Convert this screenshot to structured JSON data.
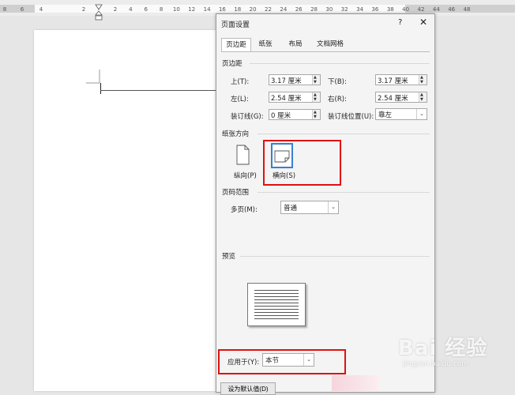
{
  "ruler": {
    "left_ticks": [
      "8",
      "6",
      "4",
      "2"
    ],
    "right_ticks": [
      "2",
      "4",
      "6",
      "8",
      "10",
      "12",
      "14",
      "16",
      "18",
      "20",
      "22",
      "24",
      "26",
      "28",
      "30",
      "32",
      "34",
      "36",
      "38",
      "40",
      "42",
      "44",
      "46",
      "48"
    ]
  },
  "dialog": {
    "title": "页面设置",
    "help_label": "?",
    "close_label": "✕",
    "tabs": [
      {
        "label": "页边距",
        "active": true
      },
      {
        "label": "纸张",
        "active": false
      },
      {
        "label": "布局",
        "active": false
      },
      {
        "label": "文档网格",
        "active": false
      }
    ],
    "margins": {
      "section_label": "页边距",
      "top_label": "上(T):",
      "top_value": "3.17 厘米",
      "bottom_label": "下(B):",
      "bottom_value": "3.17 厘米",
      "left_label": "左(L):",
      "left_value": "2.54 厘米",
      "right_label": "右(R):",
      "right_value": "2.54 厘米",
      "gutter_label": "装订线(G):",
      "gutter_value": "0 厘米",
      "gutter_pos_label": "装订线位置(U):",
      "gutter_pos_value": "靠左"
    },
    "orientation": {
      "section_label": "纸张方向",
      "portrait_label": "纵向(P)",
      "landscape_label": "横向(S)"
    },
    "pages": {
      "section_label": "页码范围",
      "multi_label": "多页(M):",
      "multi_value": "普通"
    },
    "preview": {
      "section_label": "预览"
    },
    "apply": {
      "label": "应用于(Y):",
      "value": "本节"
    },
    "default_button": "设为默认值(D)"
  },
  "watermark": {
    "brand": "Bai 经验",
    "url": "jingyan.baidu.com"
  },
  "colors": {
    "highlight": "#e01010",
    "selected_border": "#3a7fd0"
  }
}
